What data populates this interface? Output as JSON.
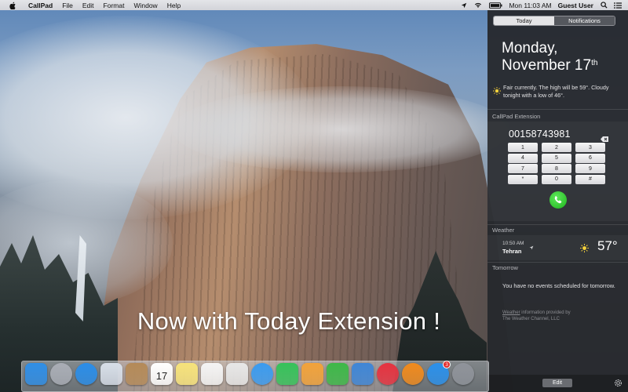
{
  "menubar": {
    "app_name": "CallPad",
    "menus": [
      "File",
      "Edit",
      "Format",
      "Window",
      "Help"
    ],
    "clock": "Mon 11:03 AM",
    "user": "Guest User"
  },
  "promo_text": "Now with Today Extension !",
  "notification_center": {
    "tabs": [
      {
        "label": "Today",
        "active": true
      },
      {
        "label": "Notifications",
        "active": false
      }
    ],
    "weekday": "Monday,",
    "date_main": "November 17",
    "date_suffix": "th",
    "forecast": "Fair currently. The high will be 59°. Cloudy tonight with a low of 46°.",
    "callpad": {
      "title": "CallPad Extension",
      "number": "00158743981",
      "keys": [
        "1",
        "2",
        "3",
        "4",
        "5",
        "6",
        "7",
        "8",
        "9",
        "*",
        "0",
        "#"
      ]
    },
    "weather": {
      "title": "Weather",
      "time": "10:50 AM",
      "city": "Tehran",
      "temperature": "57°"
    },
    "tomorrow": {
      "title": "Tomorrow",
      "message": "You have no events scheduled for tomorrow."
    },
    "credit": {
      "link": "Weather",
      "rest_line1": " information provided by",
      "line2": "The Weather Channel, LLC"
    },
    "edit_label": "Edit"
  },
  "dock": {
    "apps": [
      {
        "name": "finder-icon",
        "color": "#2f8ee6"
      },
      {
        "name": "launchpad-icon",
        "color": "#a9adb5"
      },
      {
        "name": "safari-icon",
        "color": "#2a8de8"
      },
      {
        "name": "mail-icon",
        "color": "#d7dee8"
      },
      {
        "name": "contacts-icon",
        "color": "#b48a58"
      },
      {
        "name": "calendar-icon",
        "color": "#ffffff",
        "text": "17"
      },
      {
        "name": "notes-icon",
        "color": "#f6e27a"
      },
      {
        "name": "reminders-icon",
        "color": "#f4f4f4"
      },
      {
        "name": "photos-icon",
        "color": "#e7e7e7"
      },
      {
        "name": "messages-icon",
        "color": "#3a9bf0"
      },
      {
        "name": "facetime-icon",
        "color": "#36c25a"
      },
      {
        "name": "pages-icon",
        "color": "#f1a23a"
      },
      {
        "name": "numbers-icon",
        "color": "#3db848"
      },
      {
        "name": "keynote-icon",
        "color": "#3f86d6"
      },
      {
        "name": "itunes-icon",
        "color": "#e6323f"
      },
      {
        "name": "ibooks-icon",
        "color": "#f08a1d"
      },
      {
        "name": "app-store-icon",
        "color": "#2b90ea",
        "badge": "3"
      },
      {
        "name": "system-preferences-icon",
        "color": "#8f939a"
      }
    ]
  }
}
